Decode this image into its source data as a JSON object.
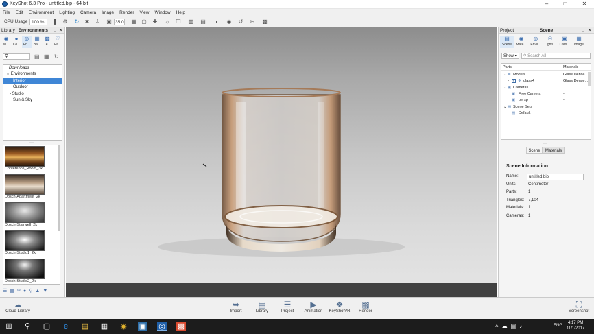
{
  "window": {
    "title": "KeyShot 6.3 Pro  -  untitled.bip  -  64 bit"
  },
  "menu": [
    "File",
    "Edit",
    "Environment",
    "Lighting",
    "Camera",
    "Image",
    "Render",
    "View",
    "Window",
    "Help"
  ],
  "toolbar": {
    "cpu_label": "CPU Usage",
    "cpu_value": "100 %",
    "fov_value": "35.0"
  },
  "library": {
    "header_left": "Library",
    "header_title": "Environments",
    "tabs": [
      "M...",
      "Co...",
      "En...",
      "Ba...",
      "Te...",
      "Fa..."
    ],
    "folders": [
      "Downloads",
      "Environments",
      "Interior",
      "Outdoor",
      "Studio",
      "Sun & Sky"
    ],
    "thumbs": [
      "Conference_Room_3k",
      "Dosch-Apartment_2k",
      "Dosch-Stairwell_2k",
      "Dosch-Studio1_2k",
      "Dosch-Studio2_2k"
    ]
  },
  "project": {
    "header_left": "Project",
    "header_title": "Scene",
    "tabs": [
      "Scene",
      "Mate...",
      "Envir...",
      "Lighti...",
      "Cam...",
      "Image"
    ],
    "show_label": "Show",
    "search_placeholder": "Search All",
    "col_parts": "Parts",
    "col_materials": "Materials",
    "tree": [
      {
        "label": "Models",
        "mat": "Glass Dense..."
      },
      {
        "label": "glass4",
        "mat": "Glass Dense..."
      },
      {
        "label": "Cameras",
        "mat": ""
      },
      {
        "label": "Free Camera",
        "mat": "-"
      },
      {
        "label": "persp",
        "mat": "-"
      },
      {
        "label": "Scene Sets",
        "mat": ""
      },
      {
        "label": "Default",
        "mat": ""
      }
    ],
    "subtabs": [
      "Scene",
      "Materials"
    ],
    "info_title": "Scene Information",
    "info": {
      "name_label": "Name:",
      "name_value": "untitled.bip",
      "units_label": "Units:",
      "units_value": "Centimeter",
      "parts_label": "Parts:",
      "parts_value": "1",
      "triangles_label": "Triangles:",
      "triangles_value": "7,104",
      "materials_label": "Materials:",
      "materials_value": "1",
      "cameras_label": "Cameras:",
      "cameras_value": "1"
    }
  },
  "bottom": {
    "cloud_library": "Cloud Library",
    "buttons": [
      "Import",
      "Library",
      "Project",
      "Animation",
      "KeyShotVR",
      "Render"
    ],
    "screenshot": "Screenshot"
  },
  "taskbar": {
    "time": "4:17 PM",
    "date": "11/1/2017",
    "lang": "ENG"
  }
}
